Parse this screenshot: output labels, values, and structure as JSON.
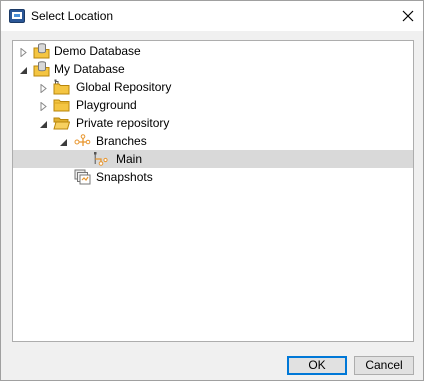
{
  "window": {
    "title": "Select Location"
  },
  "tree": [
    {
      "label": "Demo Database",
      "expander": "collapsed",
      "icon": "database-folder-icon"
    },
    {
      "label": "My Database",
      "expander": "expanded",
      "icon": "database-folder-icon"
    },
    {
      "label": "Global Repository",
      "expander": "collapsed",
      "icon": "repository-folder-icon"
    },
    {
      "label": "Playground",
      "expander": "collapsed",
      "icon": "folder-icon"
    },
    {
      "label": "Private repository",
      "expander": "expanded",
      "icon": "open-folder-icon"
    },
    {
      "label": "Branches",
      "expander": "expanded",
      "icon": "branches-icon"
    },
    {
      "label": "Main",
      "expander": "none",
      "icon": "branch-icon",
      "selected": true
    },
    {
      "label": "Snapshots",
      "expander": "none",
      "icon": "snapshots-icon"
    }
  ],
  "buttons": {
    "ok": "OK",
    "cancel": "Cancel"
  },
  "colors": {
    "folder": "#f4c542",
    "branch_accent": "#e8962e",
    "selection": "#d9d9d9",
    "default_button_border": "#0078d7"
  }
}
